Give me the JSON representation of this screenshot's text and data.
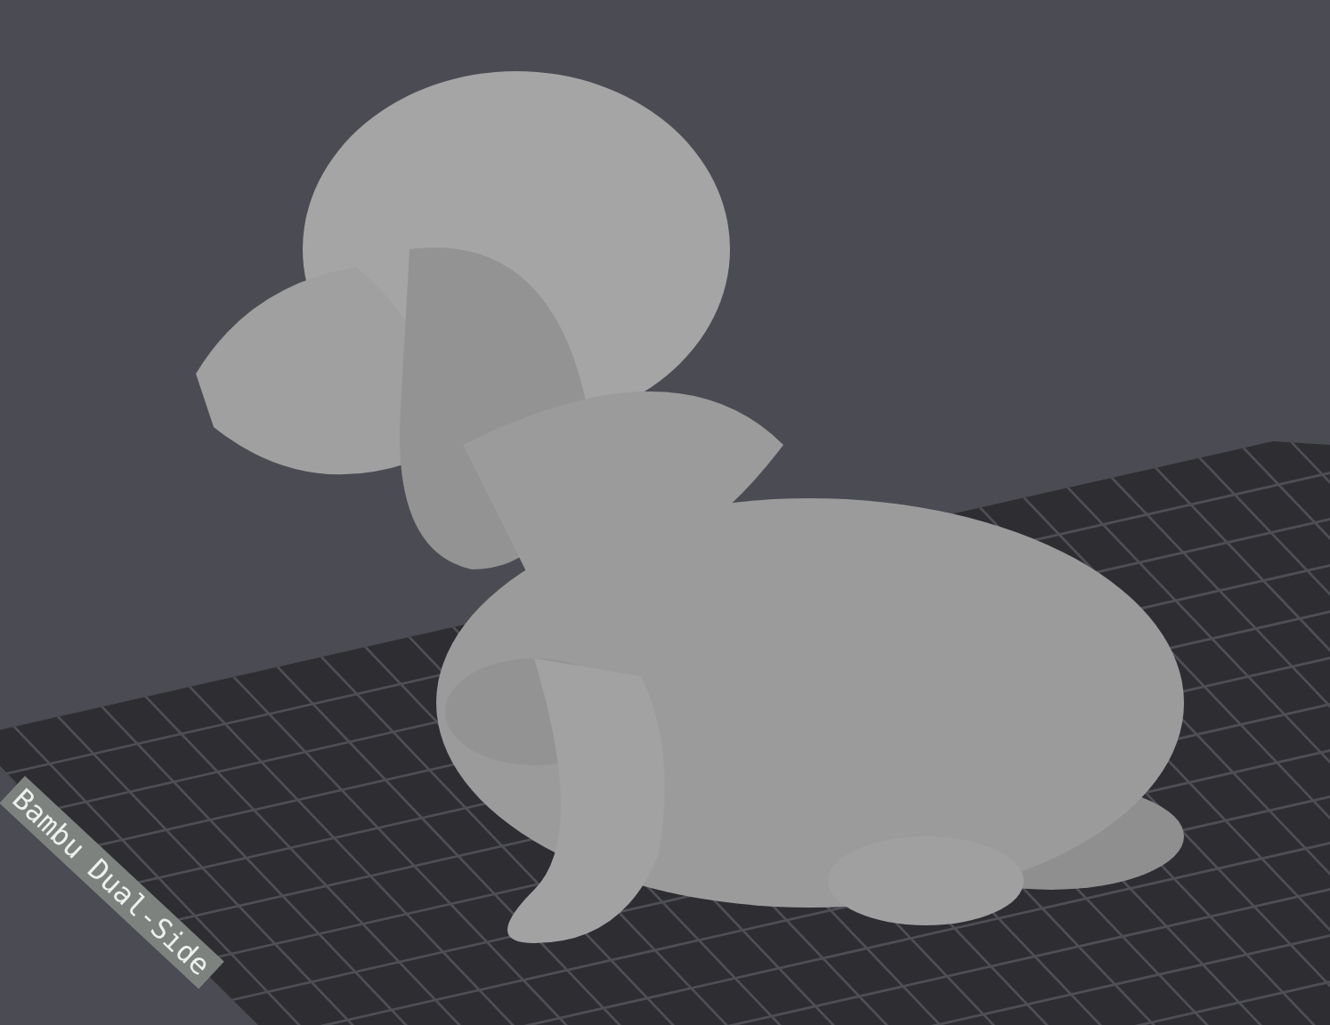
{
  "plate": {
    "label": "Bambu Dual-Side"
  }
}
